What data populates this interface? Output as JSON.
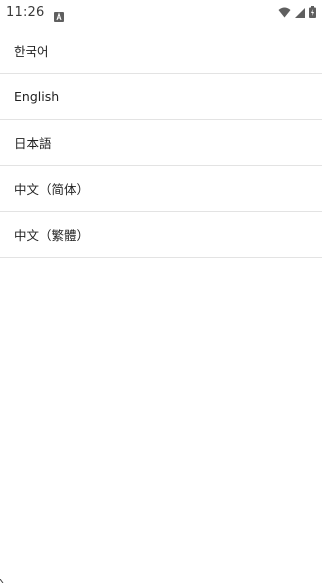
{
  "status_bar": {
    "time": "11:26",
    "notification_icon": "keyboard-a-icon",
    "wifi_icon": "wifi-icon",
    "signal_icon": "cell-signal-icon",
    "battery_icon": "battery-charging-icon"
  },
  "languages": [
    {
      "label": "한국어"
    },
    {
      "label": "English"
    },
    {
      "label": "日本語"
    },
    {
      "label": "中文（简体）"
    },
    {
      "label": "中文（繁體）"
    }
  ],
  "colors": {
    "divider": "#e3e3e3",
    "text": "#222222",
    "status_icons": "#5f5f5f"
  }
}
